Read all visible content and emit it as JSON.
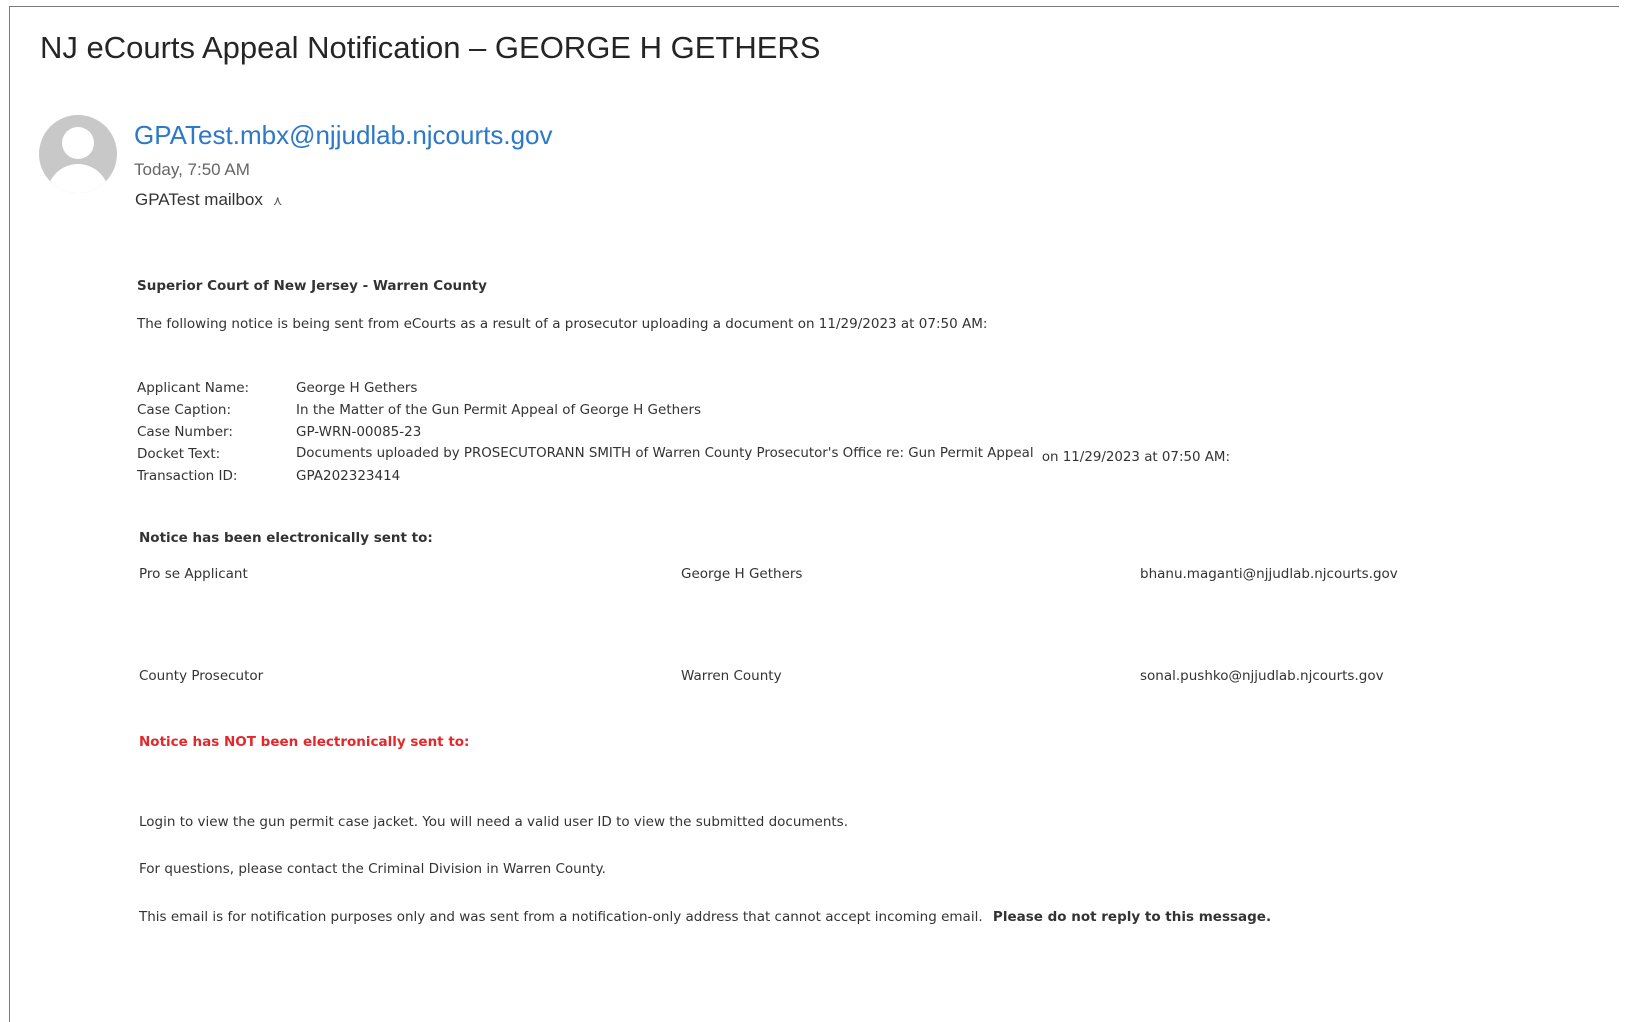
{
  "email": {
    "subject": "NJ eCourts Appeal Notification – GEORGE H GETHERS",
    "sender": "GPATest.mbx@njjudlab.njcourts.gov",
    "time": "Today, 7:50 AM",
    "mailbox": "GPATest mailbox"
  },
  "body": {
    "court": "Superior Court of New Jersey - Warren County",
    "intro": "The following notice is being sent from eCourts as a result of a prosecutor uploading a document  on 11/29/2023 at 07:50 AM:",
    "details": [
      {
        "label": "Applicant Name:",
        "value": "George H Gethers"
      },
      {
        "label": "Case Caption:",
        "value": "In the Matter of the Gun Permit Appeal of George H Gethers"
      },
      {
        "label": "Case Number:",
        "value": "GP-WRN-00085-23"
      },
      {
        "label": "Docket Text:",
        "value": "Documents uploaded by PROSECUTORANN SMITH of Warren County Prosecutor's Office re: Gun Permit Appeal",
        "suffix": "on 11/29/2023 at 07:50 AM:"
      },
      {
        "label": "Transaction ID:",
        "value": "GPA202323414"
      }
    ],
    "sent_heading": "Notice has been electronically sent to:",
    "recipients": [
      {
        "role": "Pro se Applicant",
        "name": "George H Gethers",
        "email": "bhanu.maganti@njjudlab.njcourts.gov"
      },
      {
        "role": "County Prosecutor",
        "name": "Warren County",
        "email": "sonal.pushko@njjudlab.njcourts.gov"
      }
    ],
    "not_sent_heading": "Notice has NOT been electronically sent to:",
    "login_text": "Login to view the gun permit case jacket. You will need a valid user ID to view the submitted documents.",
    "questions_text": "For questions, please contact the Criminal Division in Warren County.",
    "footer_text": "This email is for notification purposes only and was sent from a notification-only address that cannot accept incoming email.",
    "footer_bold": "Please do not reply to this message."
  },
  "colors": {
    "link": "#2b79c8",
    "warning": "#e3272b",
    "avatar": "#c8c8c8"
  }
}
